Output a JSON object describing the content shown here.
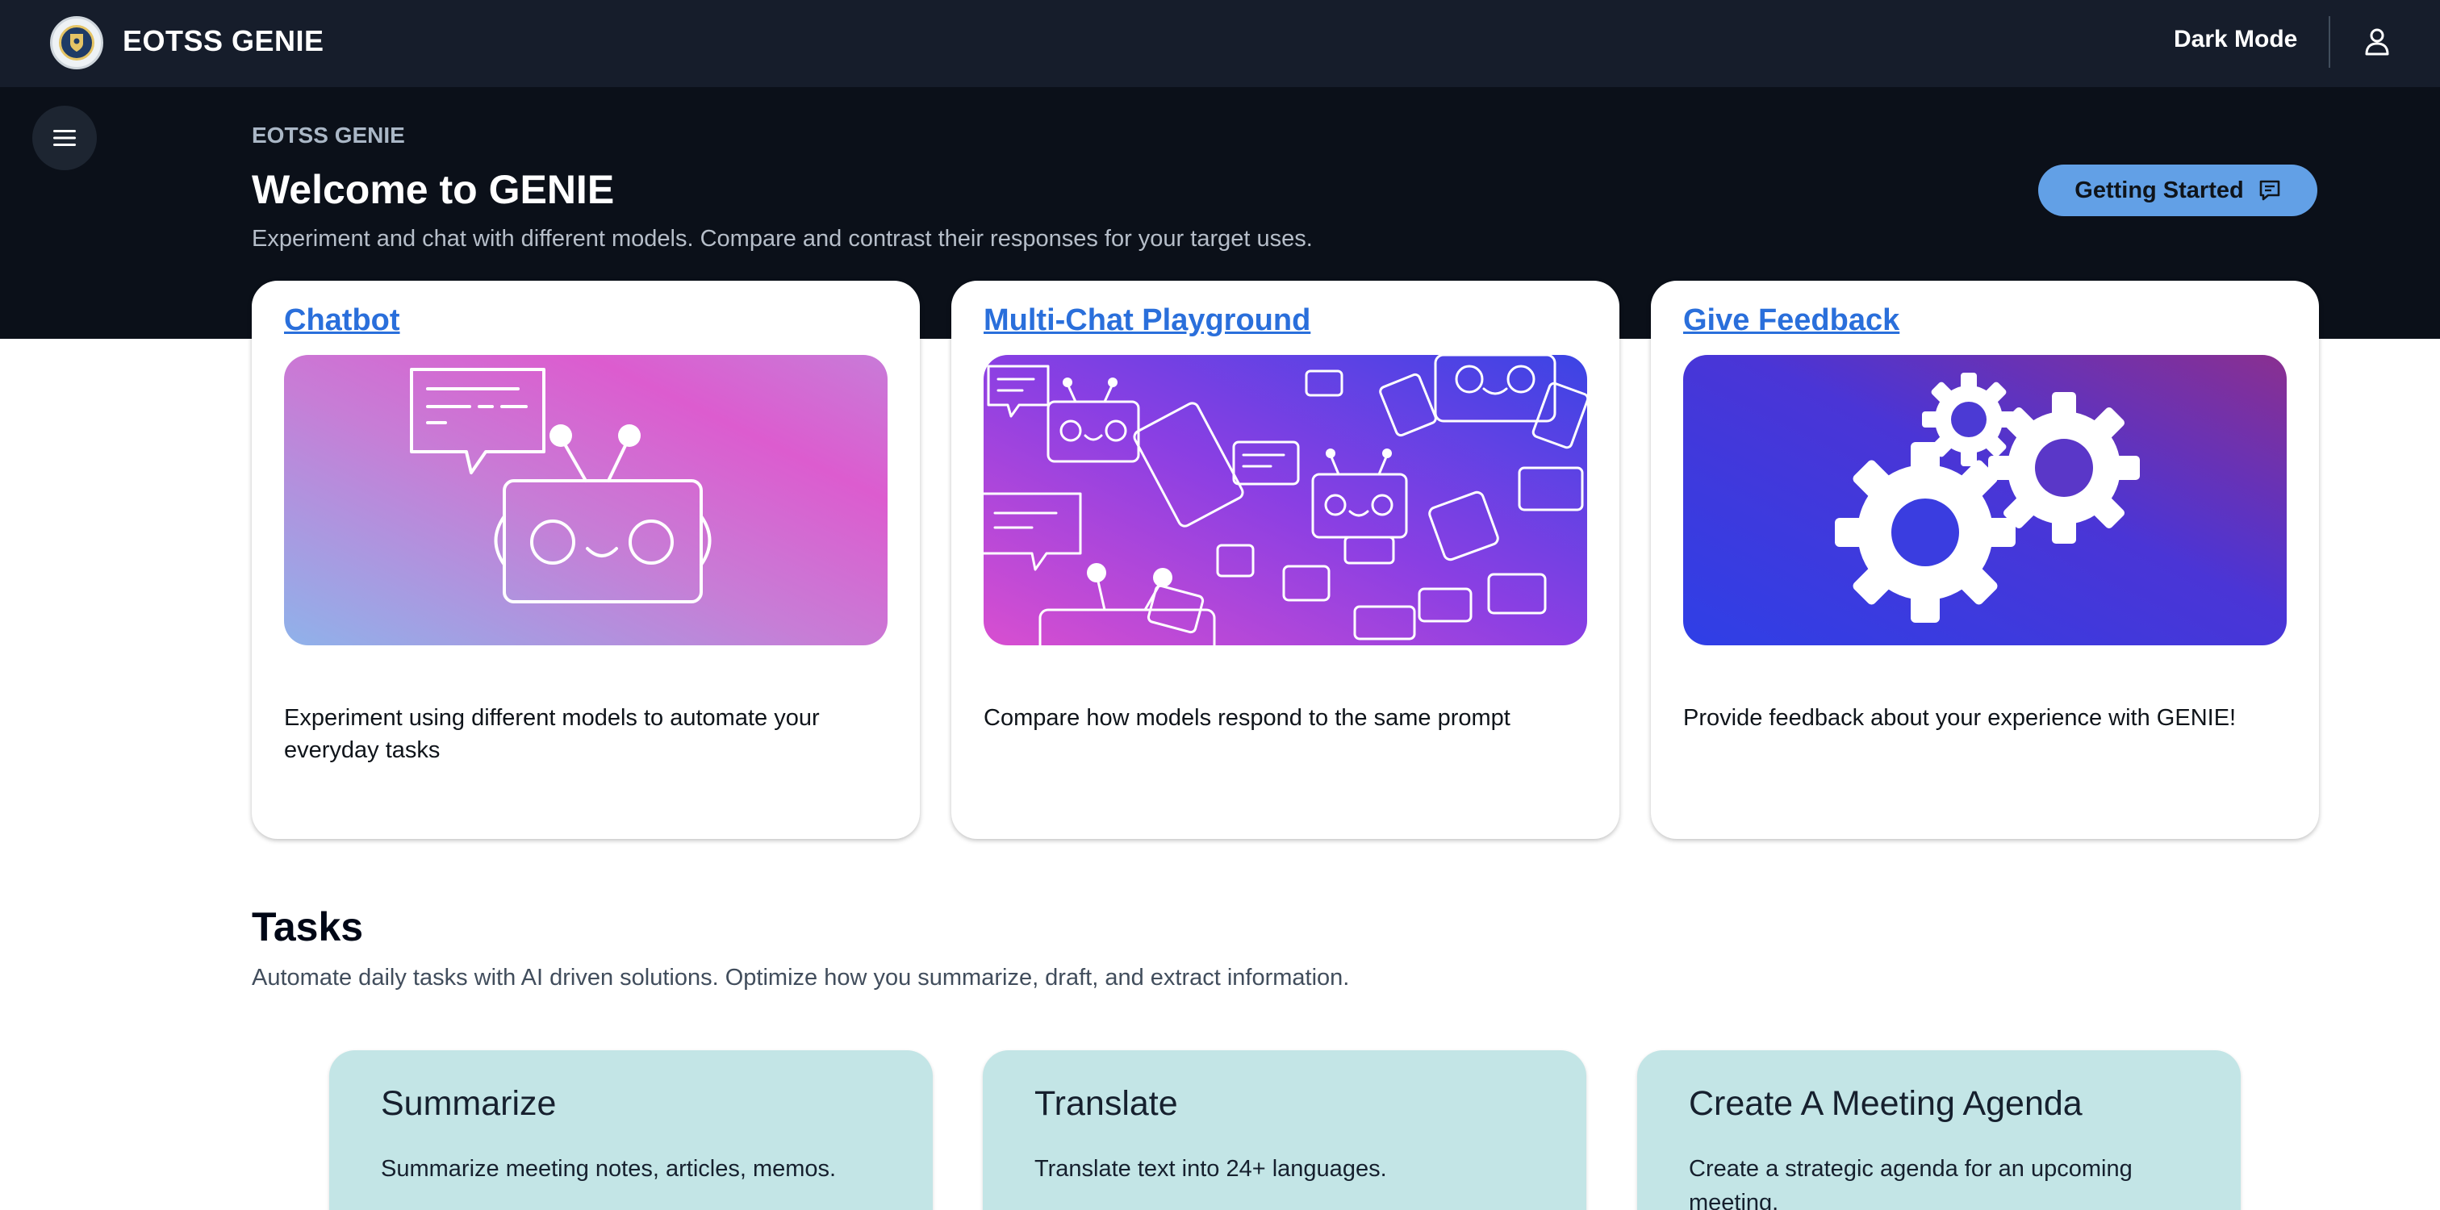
{
  "nav": {
    "brand": "EOTSS GENIE",
    "dark_mode_label": "Dark Mode"
  },
  "hero": {
    "breadcrumb": "EOTSS GENIE",
    "title": "Welcome to GENIE",
    "subtitle": "Experiment and chat with different models. Compare and contrast their responses for your target uses.",
    "getting_started_label": "Getting Started"
  },
  "cards": [
    {
      "title": "Chatbot",
      "description": "Experiment using different models to automate your everyday tasks",
      "image_icon": "robot-chat-illustration"
    },
    {
      "title": "Multi-Chat Playground",
      "description": "Compare how models respond to the same prompt",
      "image_icon": "many-robots-illustration"
    },
    {
      "title": "Give Feedback",
      "description": "Provide feedback about your experience with GENIE!",
      "image_icon": "gears-illustration"
    }
  ],
  "tasks_section": {
    "title": "Tasks",
    "subtitle": "Automate daily tasks with AI driven solutions. Optimize how you summarize, draft, and extract information.",
    "items": [
      {
        "title": "Summarize",
        "description": "Summarize meeting notes, articles, memos."
      },
      {
        "title": "Translate",
        "description": "Translate text into 24+ languages."
      },
      {
        "title": "Create A Meeting Agenda",
        "description": "Create a strategic agenda for an upcoming meeting."
      }
    ]
  },
  "colors": {
    "nav_bg": "#161d2b",
    "hero_bg": "#0b1019",
    "accent": "#62a0e6",
    "link": "#2a6fdb",
    "task_card_bg": "#c3e5e6"
  }
}
